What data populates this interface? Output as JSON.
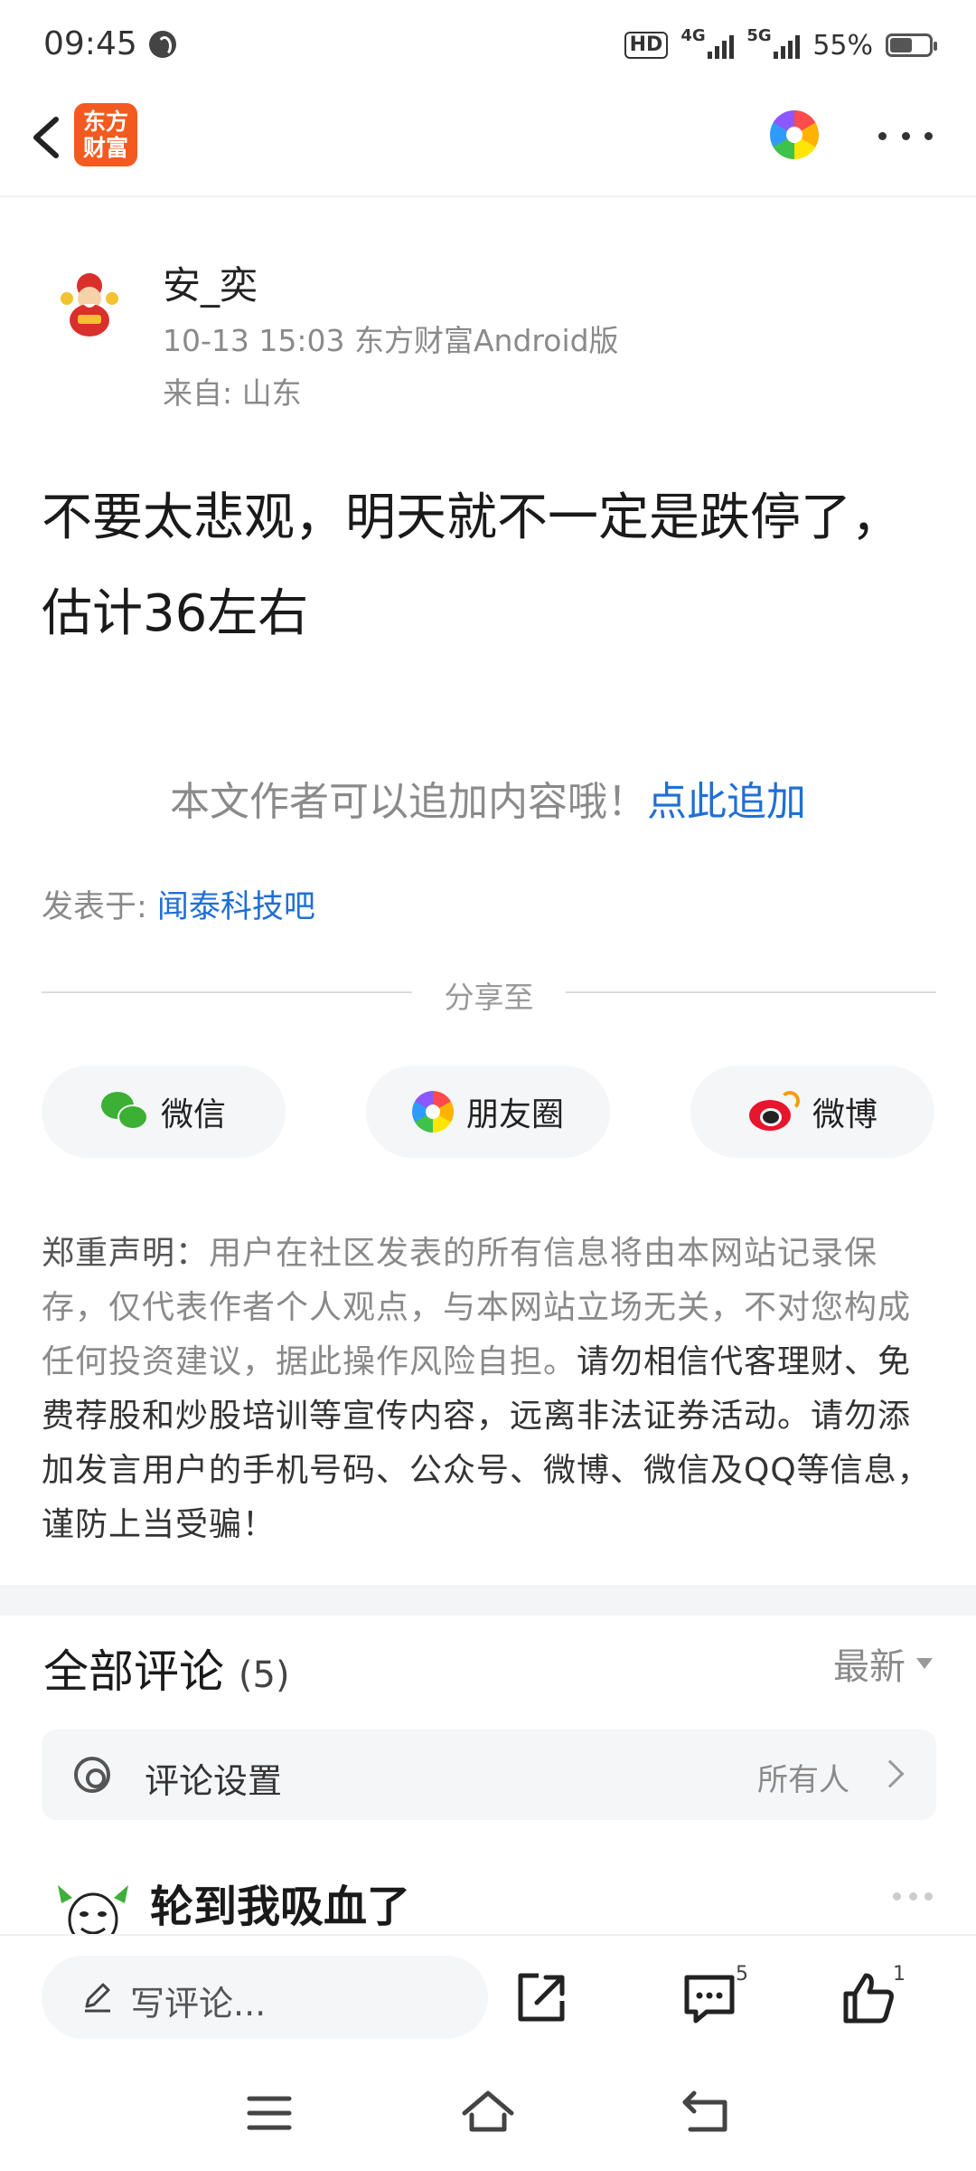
{
  "status_bar": {
    "time": "09:45",
    "hd_label": "HD",
    "network_1": "4G",
    "network_2": "5G",
    "battery": "55%"
  },
  "header": {
    "logo_text": "东方\n财富"
  },
  "author": {
    "name": "安_奕",
    "meta": "10-13 15:03 东方财富Android版",
    "from": "来自: 山东"
  },
  "post": {
    "body": "不要太悲观，明天就不一定是跌停了，估计36左右"
  },
  "append": {
    "text": "本文作者可以追加内容哦！",
    "link": "点此追加"
  },
  "posted_in": {
    "label": "发表于: ",
    "bar": "闻泰科技吧"
  },
  "share": {
    "title": "分享至",
    "wechat": "微信",
    "moments": "朋友圈",
    "weibo": "微博"
  },
  "disclaimer": {
    "label": "郑重声明：",
    "gray": "用户在社区发表的所有信息将由本网站记录保存，仅代表作者个人观点，与本网站立场无关，不对您构成任何投资建议，据此操作风险自担。",
    "dark": "请勿相信代客理财、免费荐股和炒股培训等宣传内容，远离非法证券活动。请勿添加发言用户的手机号码、公众号、微博、微信及QQ等信息，谨防上当受骗！"
  },
  "comments": {
    "title": "全部评论",
    "count": "(5)",
    "sort": "最新",
    "settings_label": "评论设置",
    "settings_value": "所有人",
    "first_comment": "轮到我吸血了"
  },
  "bottom_bar": {
    "write_placeholder": "写评论...",
    "comment_count": "5",
    "like_count": "1"
  }
}
